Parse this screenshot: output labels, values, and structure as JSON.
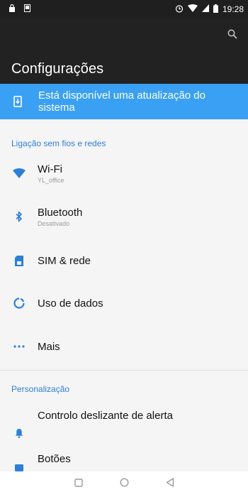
{
  "status_bar": {
    "time": "19:28"
  },
  "app_bar": {
    "title": "Configurações"
  },
  "update_banner": {
    "text": "Está disponível uma atualização do sistema"
  },
  "sections": {
    "wireless": {
      "title": "Ligação sem fios e redes"
    },
    "personalization": {
      "title": "Personalização"
    }
  },
  "items": {
    "wifi": {
      "title": "Wi-Fi",
      "subtitle": "YL_office"
    },
    "bluetooth": {
      "title": "Bluetooth",
      "subtitle": "Desativado"
    },
    "sim": {
      "title": "SIM & rede"
    },
    "data": {
      "title": "Uso de dados"
    },
    "more": {
      "title": "Mais"
    },
    "slide_alert": {
      "title": "Controlo deslizante de alerta"
    },
    "buttons": {
      "title": "Botões"
    }
  },
  "colors": {
    "accent": "#2d7fd6",
    "banner": "#39a0f4",
    "app_bar": "#222222",
    "status_bar": "#1f1f1f"
  }
}
